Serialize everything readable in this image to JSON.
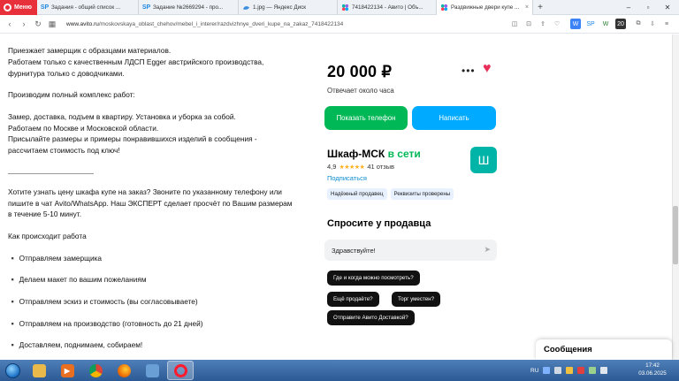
{
  "browser": {
    "menu_label": "Меню",
    "tabs": [
      {
        "icon": "sp-icon",
        "label": "Задания - общий список ..."
      },
      {
        "icon": "sp-icon",
        "label": "Задание №2669294 - про..."
      },
      {
        "icon": "yandex-disk-icon",
        "label": "1.jpg — Яндекс Диск"
      },
      {
        "icon": "avito-icon",
        "label": "7418422134 - Авито | Объ..."
      },
      {
        "icon": "avito-icon",
        "label": "Раздвижные двери купе ..."
      }
    ],
    "new_tab": "+",
    "url_domain": "www.avito.ru",
    "url_path": "/moskovskaya_oblast_chehov/mebel_i_interer/razdvizhnye_dveri_kupe_na_zakaz_7418422134"
  },
  "description": {
    "lines": [
      "Приезжает замерщик с образцами материалов.",
      "Работаем только с качественным ЛДСП Egger австрийского производства,\nфурнитура только с доводчиками.",
      "Производим полный комплекс работ:",
      "Замер, доставка, подъем в квартиру. Установка и уборка за собой.\nРаботаем по Москве и Московской области.\nПрисылайте размеры и примеры понравившихся изделий в сообщения -\nрассчитаем стоимость под ключ!",
      "_____________________",
      "Хотите узнать цену шкафа купе на заказ? Звоните по указанному телефону или\nпишите в чат Avito/WhatsApp. Наш ЭКСПЕРТ сделает просчёт по Вашим размерам\nв течение 5-10 минут.",
      "Как происходит работа",
      "▪️ Отправляем замерщика",
      "▪️ Делаем макет по вашим пожеланиям",
      "▪️ Отправляем эскиз и стоимость (вы согласовываете)",
      "▪️ Отправляем на производство (готовность до 21 дней)",
      "▪️ Доставляем, поднимаем, собираем!"
    ]
  },
  "listing": {
    "price": "20 000 ₽",
    "response_time": "Отвечает около часа",
    "show_phone_label": "Показать телефон",
    "write_label": "Написать",
    "seller_name": "Шкаф-МСК",
    "seller_status": "в сети",
    "rating_value": "4,9",
    "stars": "★★★★★",
    "reviews": "41 отзыв",
    "subscribe_label": "Подписаться",
    "logo_letter": "Ш",
    "badges": [
      "Надёжный продавец",
      "Реквизиты проверены"
    ],
    "ask_title": "Спросите у продавца",
    "message_value": "Здравствуйте!",
    "quick_questions": [
      "Где и когда можно посмотреть?",
      "Ещё продаёте?",
      "Торг уместен?",
      "Отправите Авито Доставкой?"
    ],
    "messages_panel_label": "Сообщения"
  },
  "taskbar": {
    "language": "RU",
    "time": "17:42",
    "date": "03.06.2025"
  },
  "colors": {
    "accent_green": "#00b856",
    "accent_blue": "#00aaff",
    "heart": "#e8305a",
    "opera_red": "#e8303a"
  }
}
